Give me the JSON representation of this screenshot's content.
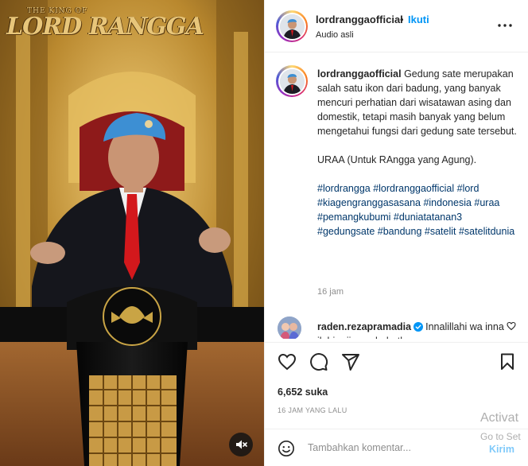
{
  "media": {
    "watermark_small": "THE KING OF",
    "watermark_big": "LORD RANGGA"
  },
  "header": {
    "username": "lordranggaofficial",
    "separator": "•",
    "follow_label": "Ikuti",
    "audio_label": "Audio asli"
  },
  "caption": {
    "username": "lordranggaofficial",
    "text": "Gedung sate merupakan salah satu ikon dari badung, yang banyak mencuri perhatian dari wisatawan asing dan domestik, tetapi masih banyak yang belum mengetahui fungsi dari gedung sate tersebut.",
    "text2": "URAA (Untuk RAngga yang Agung).",
    "hashtags": [
      "#lordrangga",
      "#lordranggaofficial",
      "#lord",
      "#kiagengranggasasana",
      "#indonesia",
      "#uraa",
      "#pemangkubumi",
      "#duniatatanan3",
      "#gedungsate",
      "#bandung",
      "#satelit",
      "#satelitdunia"
    ],
    "time": "16 jam"
  },
  "comment": {
    "username": "raden.rezapramadia",
    "text": "Innalillahi wa inna ilahi rojiun sahabatku"
  },
  "actions": {
    "likes": "6,652 suka",
    "posted": "16 JAM YANG LALU"
  },
  "composer": {
    "placeholder": "Tambahkan komentar...",
    "send_label": "Kirim"
  },
  "os_overlay": {
    "line1": "Activat",
    "line2": "Go to Set"
  },
  "colors": {
    "link_blue": "#0095f6",
    "hashtag": "#00376b",
    "muted": "#8e8e8e"
  }
}
